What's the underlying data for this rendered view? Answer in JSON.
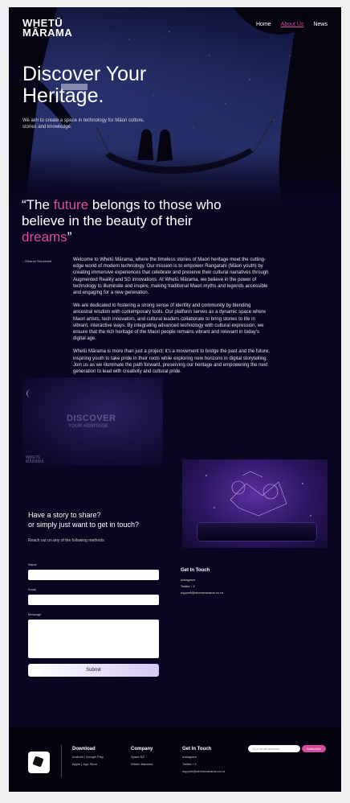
{
  "brand": {
    "logo_line1": "WHETŪ",
    "logo_line2": "MĀRAMA"
  },
  "nav": [
    "Home",
    "About Us",
    "News"
  ],
  "hero": {
    "title_line1": "Discover Your",
    "title_line2": "Heritage.",
    "subtitle": "We aim to create a space in technology for Māori culture, stories and knowledge."
  },
  "quote": {
    "part1": "“The ",
    "highlight1": "future",
    "part2": " belongs to those who believe in the beauty of their ",
    "highlight2": "dreams",
    "part3": "”",
    "author": "– Eleanor Roosevelt"
  },
  "body": [
    "Welcome to Whetū Mārama, where the timeless stories of Maori heritage meet the cutting-edge world of modern technology. Our mission is to empower Rangatahi (Māori youth) by creating immersive experiences that celebrate and preserve their cultural narratives through Augmented Reality and 5G innovations. At Whetū Mārama, we believe in the power of technology to illuminate and inspire, making traditional Maori myths and legends accessible and engaging for a new generation.",
    "We are dedicated to fostering a strong sense of identity and community by blending ancestral wisdom with contemporary tools. Our platform serves as a dynamic space where Maori artists, tech innovators, and cultural leaders collaborate to bring stories to life in vibrant, interactive ways. By integrating advanced technology with cultural expression, we ensure that the rich heritage of the Maori people remains vibrant and relevant in today's digital age.",
    "Whetū Mārama is more than just a project; it's a movement to bridge the past and the future, inspiring youth to take pride in their roots while exploring new horizons in digital storytelling. Join us as we illuminate the path forward, preserving our heritage and empowering the next generation to lead with creativity and cultural pride."
  ],
  "promo": {
    "line1": "DISCOVER",
    "line2": "YOUR HERITAGE",
    "logo1": "WHETŪ",
    "logo2": "MĀRAMA"
  },
  "contact": {
    "heading_line1": "Have a story to share?",
    "heading_line2": "or simply just want to get in touch?",
    "sub": "Reach out on any of the following methods:",
    "name_label": "Name",
    "email_label": "Email",
    "message_label": "Message",
    "submit": "Submit",
    "git_heading": "Get In Touch",
    "git_items": [
      "Instagram",
      "Twitter / X",
      "support@whetumarama.co.nz"
    ]
  },
  "footer": {
    "download_heading": "Download",
    "download_items": [
      "Android | Google Play",
      "Apple | App Store"
    ],
    "company_heading": "Company",
    "company_items": [
      "Spark NZ",
      "Whetu Marama"
    ],
    "git_heading": "Get In Touch",
    "git_items": [
      "Instagram",
      "Twitter / X",
      "support@whetumarama.co.nz"
    ],
    "email_placeholder": "Your email address",
    "subscribe": "Subscribe"
  },
  "colors": {
    "accent": "#d84c9f",
    "background": "#0a0520"
  }
}
